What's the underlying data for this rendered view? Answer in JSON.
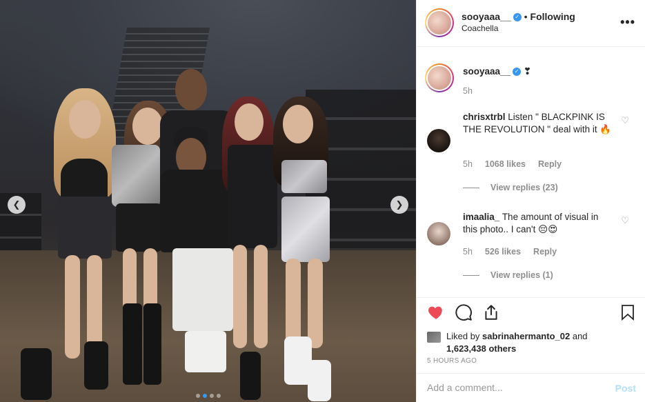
{
  "post": {
    "photo_nav": {
      "prev_icon": "chevron-left-icon",
      "next_icon": "chevron-right-icon"
    },
    "carousel": {
      "count": 4,
      "active_index": 1
    }
  },
  "header": {
    "username": "sooyaaa__",
    "separator": "•",
    "follow_status": "Following",
    "location": "Coachella",
    "more_label": "•••"
  },
  "caption": {
    "username": "sooyaaa__",
    "emoji": "❣",
    "time": "5h"
  },
  "comments": [
    {
      "username": "chrisxtrbl",
      "text": "Listen \" BLACKPINK IS THE REVOLUTION \" deal with it 🔥",
      "time": "5h",
      "likes": "1068 likes",
      "reply": "Reply",
      "view_replies": "View replies (23)"
    },
    {
      "username": "imaalia_",
      "text": "The amount of visual in this photo.. I can't 😔😍",
      "time": "5h",
      "likes": "526 likes",
      "reply": "Reply",
      "view_replies": "View replies (1)"
    }
  ],
  "actions": {
    "like_icon": "heart-icon",
    "comment_icon": "comment-icon",
    "share_icon": "share-icon",
    "save_icon": "bookmark-icon",
    "like_color": "#ed4956"
  },
  "likes": {
    "prefix": "Liked by",
    "user": "sabrinahermanto_02",
    "and": "and",
    "others": "1,623,438 others"
  },
  "timestamp": "5 HOURS AGO",
  "add_comment": {
    "placeholder": "Add a comment...",
    "post_label": "Post"
  }
}
